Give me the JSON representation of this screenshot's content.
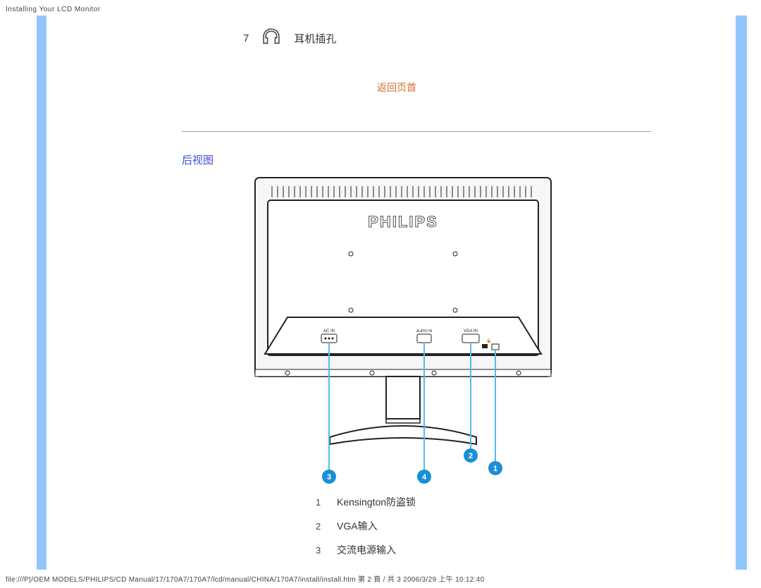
{
  "header": "Installing Your LCD Monitor",
  "front_labels": {
    "item7": {
      "num": "7",
      "label": "耳机插孔"
    }
  },
  "links": {
    "back_top": "返回页首"
  },
  "section": {
    "rear_view_title": "后视图"
  },
  "monitor": {
    "brand": "PHILIPS",
    "port_labels": {
      "ac": "AC",
      "vga": "VGA IN"
    },
    "callouts": [
      {
        "num": "1"
      },
      {
        "num": "2"
      },
      {
        "num": "3"
      },
      {
        "num": "4"
      }
    ]
  },
  "rear_labels": [
    {
      "num": "1",
      "label": "Kensington防盗锁"
    },
    {
      "num": "2",
      "label": "VGA输入"
    },
    {
      "num": "3",
      "label": "交流电源输入"
    }
  ],
  "footer": "file:///P|/OEM MODELS/PHILIPS/CD Manual/17/170A7/170A7/lcd/manual/CHINA/170A7/install/install.htm 第 2 頁 / 共 3 2006/3/29 上午 10:12:40"
}
